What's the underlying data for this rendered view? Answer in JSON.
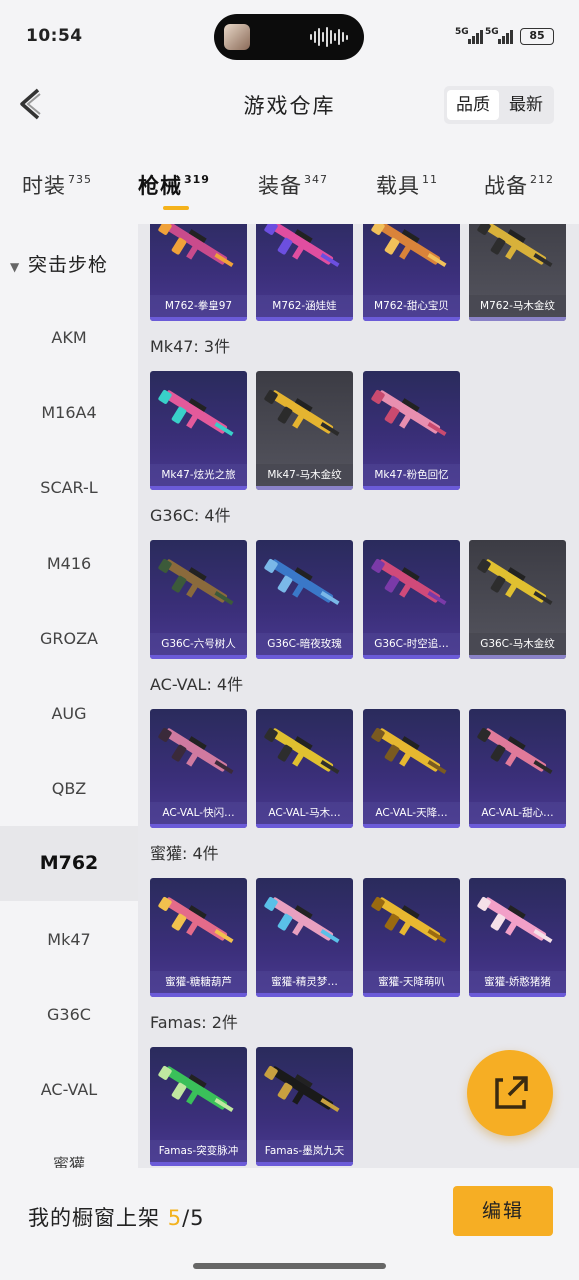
{
  "status": {
    "time": "10:54",
    "sig1": "5G",
    "sig2": "5G",
    "battery": "85"
  },
  "header": {
    "title": "游戏仓库",
    "sort_quality": "品质",
    "sort_latest": "最新"
  },
  "tabs": [
    {
      "label": "时装",
      "count": "735"
    },
    {
      "label": "枪械",
      "count": "319"
    },
    {
      "label": "装备",
      "count": "347"
    },
    {
      "label": "载具",
      "count": "11"
    },
    {
      "label": "战备",
      "count": "212"
    }
  ],
  "sidebar": {
    "category": "突击步枪",
    "items": [
      "AKM",
      "M16A4",
      "SCAR-L",
      "M416",
      "GROZA",
      "AUG",
      "QBZ",
      "M762",
      "Mk47",
      "G36C",
      "AC-VAL",
      "蜜獾"
    ],
    "selected": "M762"
  },
  "sections": [
    {
      "title": "",
      "items": [
        "M762-拳皇97",
        "M762-涵娃娃",
        "M762-甜心宝贝",
        "M762-马木金纹"
      ]
    },
    {
      "title": "Mk47: 3件",
      "items": [
        "Mk47-炫光之旅",
        "Mk47-马木金纹",
        "Mk47-粉色回忆"
      ]
    },
    {
      "title": "G36C: 4件",
      "items": [
        "G36C-六号树人",
        "G36C-暗夜玫瑰",
        "G36C-时空追…",
        "G36C-马木金纹"
      ]
    },
    {
      "title": "AC-VAL: 4件",
      "items": [
        "AC-VAL-快闪…",
        "AC-VAL-马木…",
        "AC-VAL-天降…",
        "AC-VAL-甜心…"
      ]
    },
    {
      "title": "蜜獾: 4件",
      "items": [
        "蜜獾-糖糖葫芦",
        "蜜獾-精灵梦…",
        "蜜獾-天降萌叭",
        "蜜獾-娇憨猪猪"
      ]
    },
    {
      "title": "Famas: 2件",
      "items": [
        "Famas-突变脉冲",
        "Famas-墨岚九天"
      ]
    }
  ],
  "bottom": {
    "showcase_label": "我的橱窗上架",
    "current": "5",
    "total": "/5",
    "edit_label": "编辑"
  },
  "colors": {
    "accent": "#f6ae24",
    "card": "#3b2f7a"
  }
}
